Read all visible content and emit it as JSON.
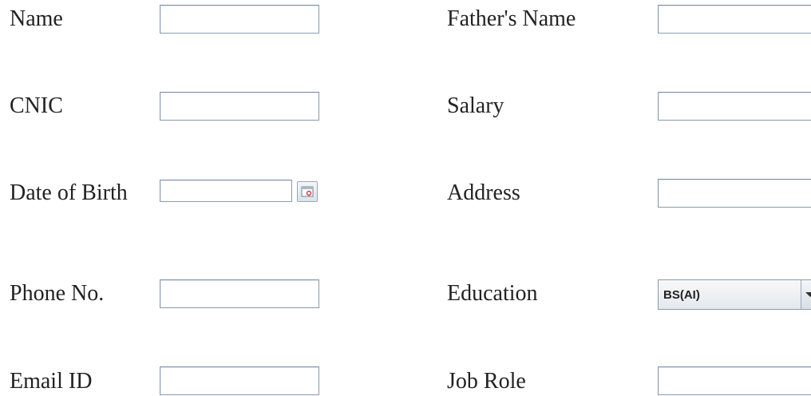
{
  "form": {
    "left": [
      {
        "label": "Name",
        "value": ""
      },
      {
        "label": "CNIC",
        "value": ""
      },
      {
        "label": "Date of Birth",
        "value": ""
      },
      {
        "label": "Phone No.",
        "value": ""
      },
      {
        "label": "Email ID",
        "value": ""
      }
    ],
    "right": [
      {
        "label": "Father's Name",
        "value": ""
      },
      {
        "label": "Salary",
        "value": ""
      },
      {
        "label": "Address",
        "value": ""
      },
      {
        "label": "Education",
        "selected": "BS(AI)"
      },
      {
        "label": "Job Role",
        "value": ""
      }
    ]
  },
  "icons": {
    "date_picker": "calendar-icon",
    "education_dropdown": "chevron-down-icon"
  }
}
